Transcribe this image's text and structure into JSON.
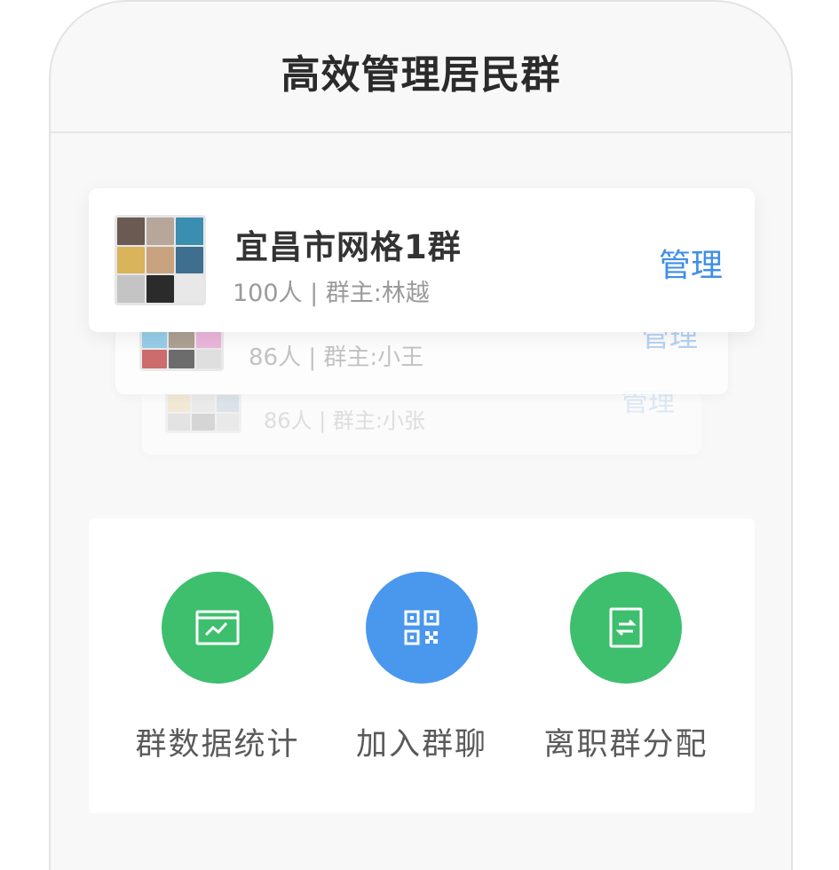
{
  "header": {
    "title": "高效管理居民群"
  },
  "groups": [
    {
      "name": "宜昌市网格1群",
      "meta": "100人 | 群主:林越",
      "manage": "管理"
    },
    {
      "meta": "86人 | 群主:小王",
      "manage": "管理"
    },
    {
      "meta": "86人 | 群主:小张",
      "manage": "管理"
    }
  ],
  "avatar_colors": [
    "#6b5a52",
    "#b7a79b",
    "#3a8fb0",
    "#d9b45a",
    "#c9a27f",
    "#3e6f8f",
    "#c4c4c4",
    "#2b2b2b",
    "#e8e8e8"
  ],
  "actions": [
    {
      "label": "群数据统计",
      "icon": "chart-icon",
      "color": "#3dbf6e"
    },
    {
      "label": "加入群聊",
      "icon": "qr-code-icon",
      "color": "#4a97ee"
    },
    {
      "label": "离职群分配",
      "icon": "transfer-icon",
      "color": "#3dbf6e"
    }
  ]
}
